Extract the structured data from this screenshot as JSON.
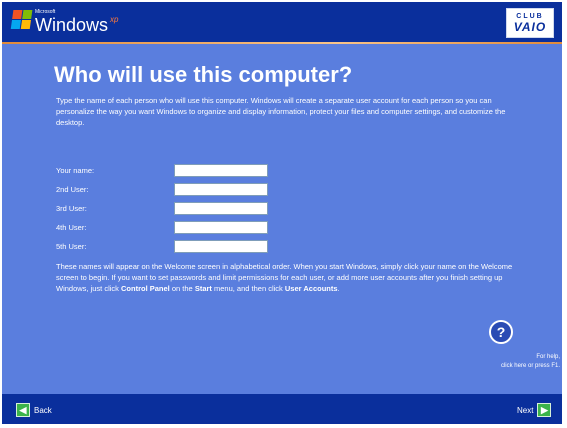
{
  "header": {
    "microsoft_label": "Microsoft",
    "windows_label": "Windows",
    "xp_label": "xp",
    "vaio_club": "CLUB",
    "vaio_brand": "VAIO"
  },
  "title": "Who will use this computer?",
  "intro": "Type the name of each person who will use this computer. Windows will create a separate user account for each person so you can personalize the way you want Windows to organize and display information, protect your files and computer settings, and customize the desktop.",
  "fields": [
    {
      "label": "Your name:",
      "value": ""
    },
    {
      "label": "2nd User:",
      "value": ""
    },
    {
      "label": "3rd User:",
      "value": ""
    },
    {
      "label": "4th User:",
      "value": ""
    },
    {
      "label": "5th User:",
      "value": ""
    }
  ],
  "info": {
    "part1": "These names will appear on the Welcome screen in alphabetical order. When you start Windows, simply click your name on the Welcome screen to begin. If you want to set passwords and limit permissions for each user, or add more user accounts after you finish setting up Windows, just click ",
    "bold1": "Control Panel",
    "part2": " on the ",
    "bold2": "Start",
    "part3": " menu, and then click ",
    "bold3": "User Accounts",
    "part4": "."
  },
  "help": {
    "icon_glyph": "?",
    "line1": "For help,",
    "line2": "click here or press F1."
  },
  "nav": {
    "back_label": "Back",
    "next_label": "Next"
  }
}
